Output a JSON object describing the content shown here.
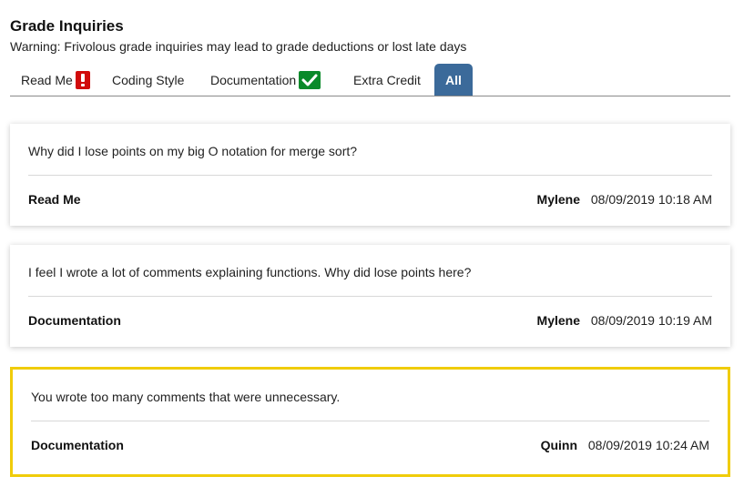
{
  "header": {
    "title": "Grade Inquiries",
    "warning": "Warning: Frivolous grade inquiries may lead to grade deductions or lost late days"
  },
  "tabs": [
    {
      "label": "Read Me",
      "status": "error",
      "icon": "exclamation-icon",
      "color": "#d10b0b"
    },
    {
      "label": "Coding Style"
    },
    {
      "label": "Documentation",
      "status": "ok",
      "icon": "checkmark-icon",
      "color": "#0a8a2a"
    },
    {
      "label": "Extra Credit"
    },
    {
      "label": "All",
      "active": true,
      "color": "#3b6a9a"
    }
  ],
  "posts": [
    {
      "text": "Why did I lose points on my big O notation for merge sort?",
      "category": "Read Me",
      "author": "Mylene",
      "timestamp": "08/09/2019 10:18 AM"
    },
    {
      "text": "I feel I wrote a lot of comments explaining functions. Why did lose points here?",
      "category": "Documentation",
      "author": "Mylene",
      "timestamp": "08/09/2019 10:19 AM"
    },
    {
      "text": "You wrote too many comments that were unnecessary.",
      "category": "Documentation",
      "author": "Quinn",
      "timestamp": "08/09/2019 10:24 AM",
      "highlighted": true,
      "highlight_color": "#f0cc0a"
    }
  ]
}
